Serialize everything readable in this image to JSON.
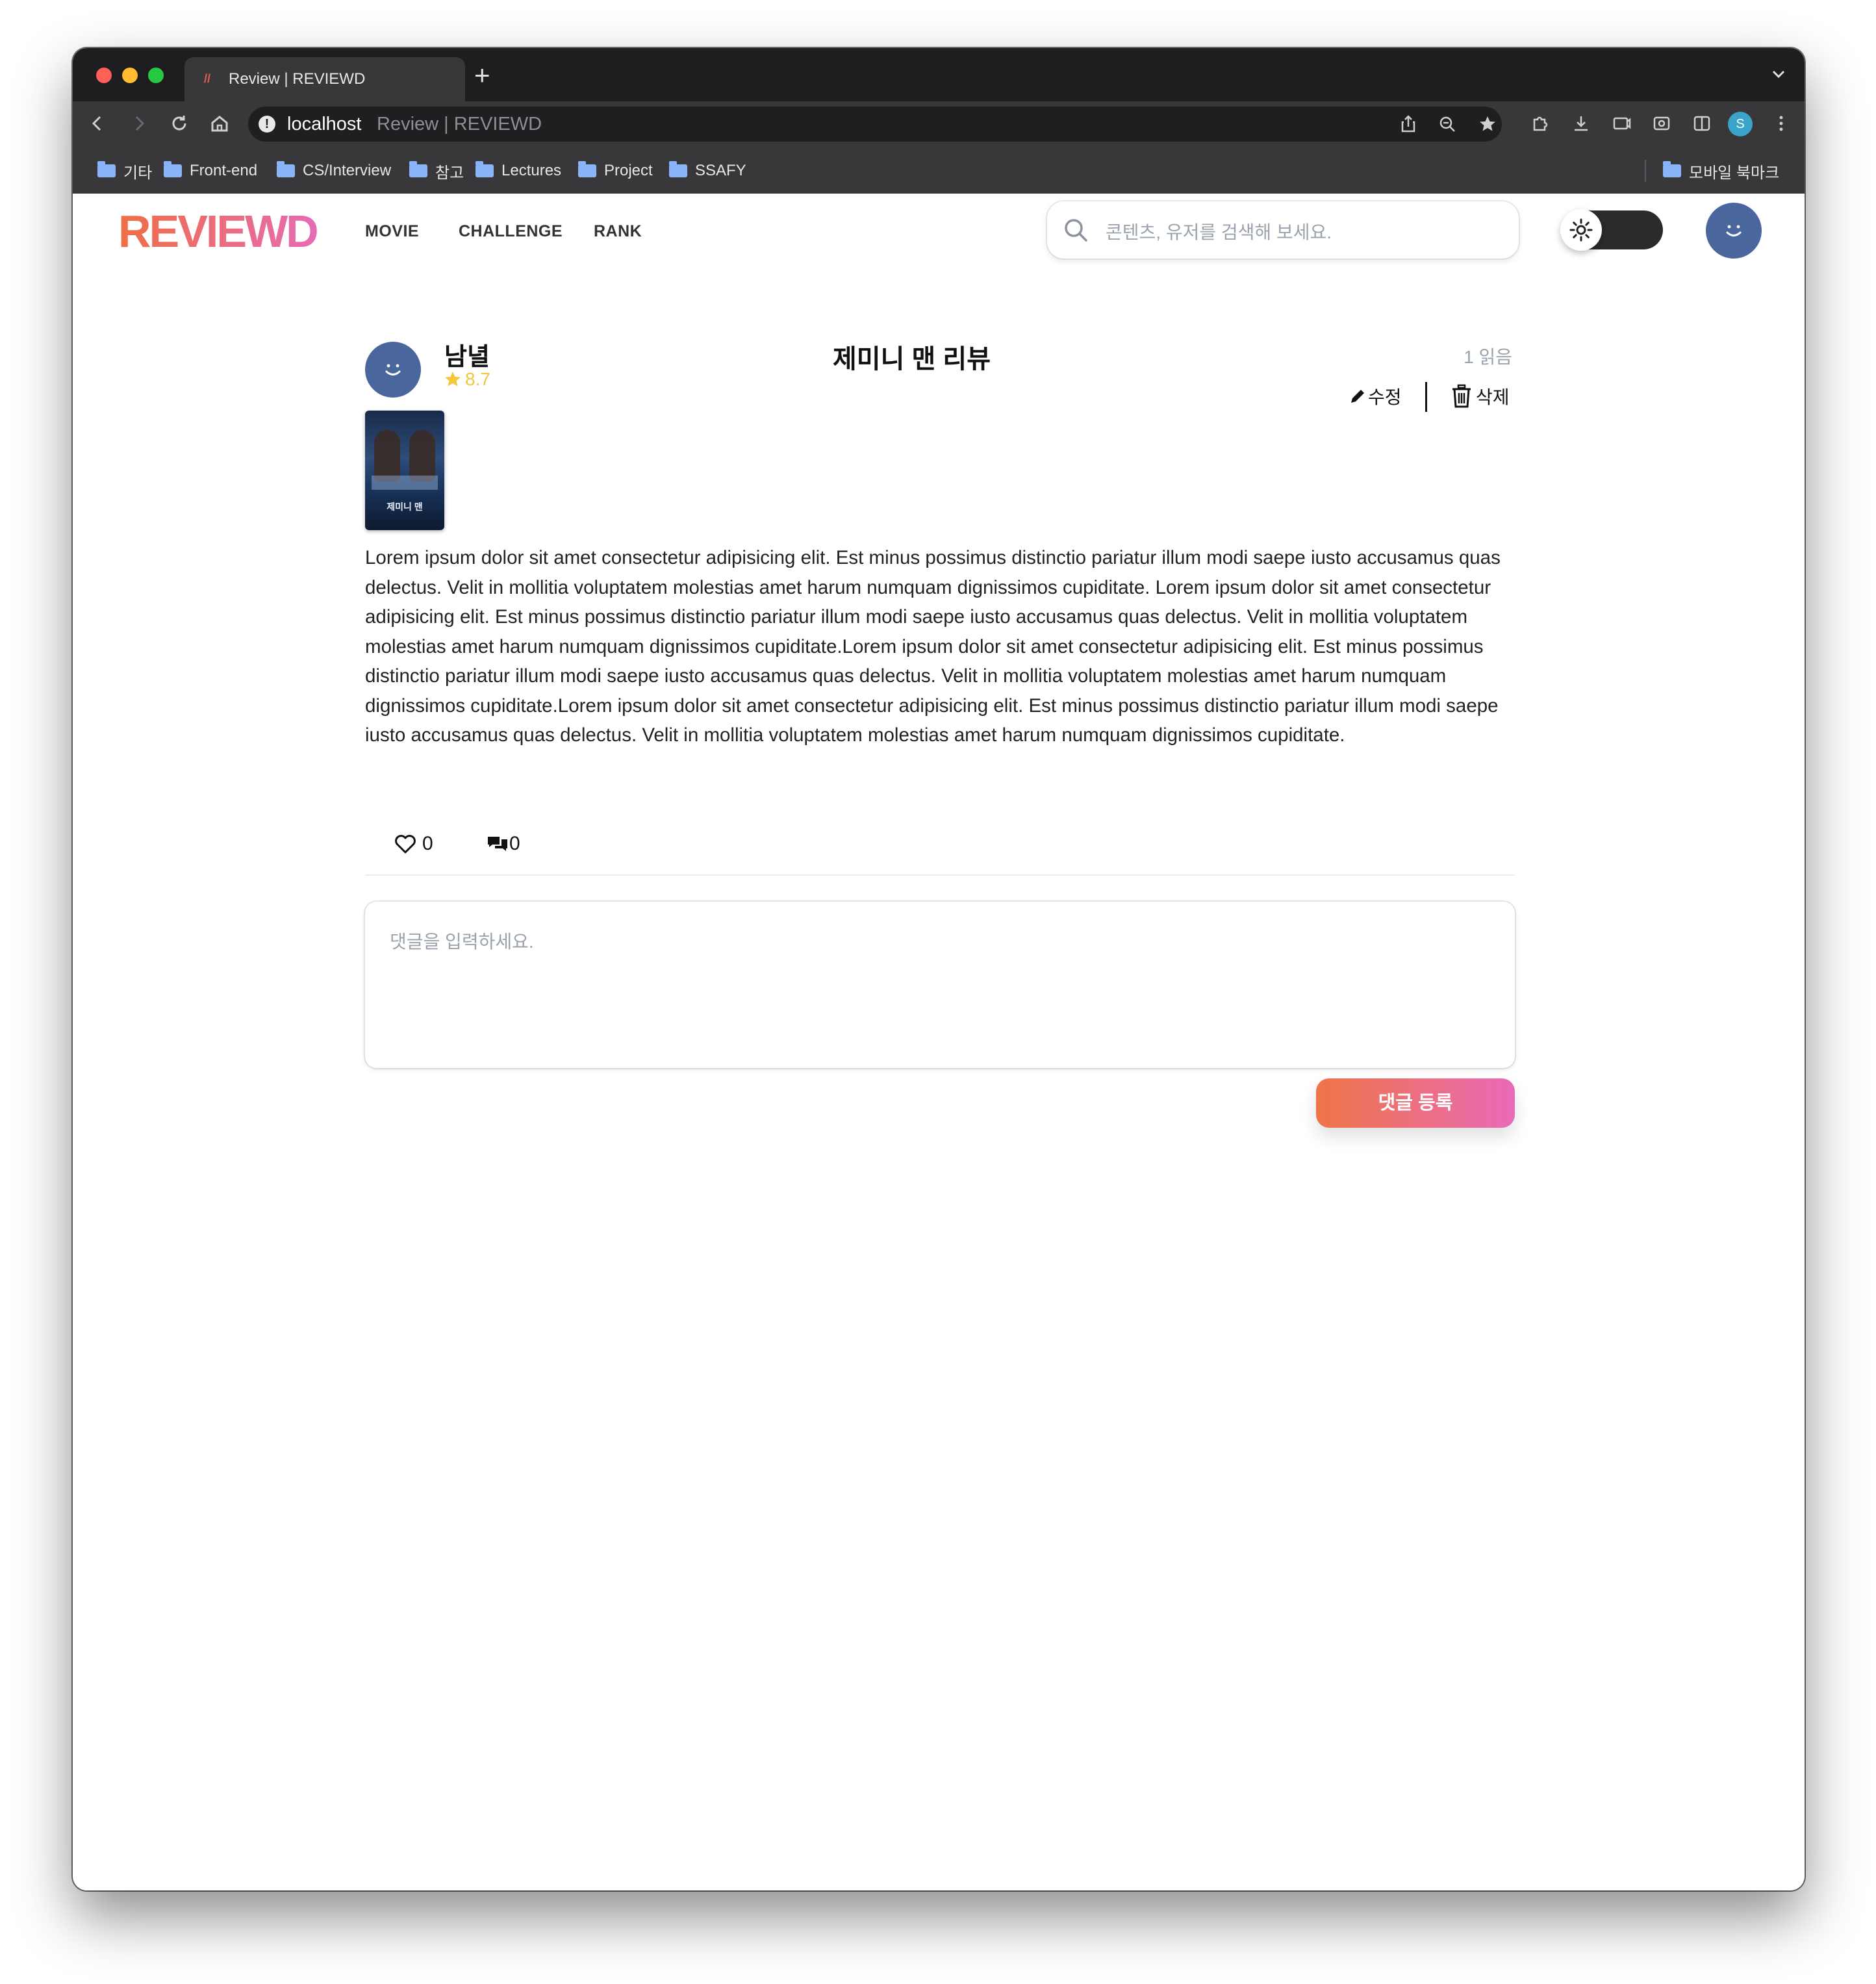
{
  "browser": {
    "tab_title": "Review | REVIEWD",
    "new_tab": "+",
    "address_host": "localhost",
    "address_title": "Review | REVIEWD",
    "profile_initial": "S",
    "bookmarks": [
      "기타",
      "Front-end",
      "CS/Interview",
      "참고",
      "Lectures",
      "Project",
      "SSAFY"
    ],
    "mobile_bookmarks": "모바일 북마크",
    "traffic_colors": [
      "#fe5f57",
      "#febc2e",
      "#28c840"
    ]
  },
  "app": {
    "logo": "REVIEWD",
    "nav": [
      "MOVIE",
      "CHALLENGE",
      "RANK"
    ],
    "search_placeholder": "콘텐츠, 유저를 검색해 보세요.",
    "theme_toggle_icon": "sun-icon",
    "accent_gradient": [
      "#ee6f45",
      "#e66bb4"
    ],
    "avatar_color": "#4a679d"
  },
  "review": {
    "author": "남녈",
    "rating": "8.7",
    "title": "제미니 맨 리뷰",
    "reads": "1 읽음",
    "edit_label": "수정",
    "delete_label": "삭제",
    "poster_text": "제미니 맨",
    "content": "Lorem ipsum dolor sit amet consectetur adipisicing elit. Est minus possimus distinctio pariatur illum modi saepe iusto accusamus quas delectus. Velit in mollitia voluptatem molestias amet harum numquam dignissimos cupiditate. Lorem ipsum dolor sit amet consectetur adipisicing elit. Est minus possimus distinctio pariatur illum modi saepe iusto accusamus quas delectus. Velit in mollitia voluptatem molestias amet harum numquam dignissimos cupiditate.Lorem ipsum dolor sit amet consectetur adipisicing elit. Est minus possimus distinctio pariatur illum modi saepe iusto accusamus quas delectus. Velit in mollitia voluptatem molestias amet harum numquam dignissimos cupiditate.Lorem ipsum dolor sit amet consectetur adipisicing elit. Est minus possimus distinctio pariatur illum modi saepe iusto accusamus quas delectus. Velit in mollitia voluptatem molestias amet harum numquam dignissimos cupiditate.",
    "likes": "0",
    "comments": "0"
  },
  "comment_form": {
    "placeholder": "댓글을 입력하세요.",
    "submit_label": "댓글 등록"
  }
}
